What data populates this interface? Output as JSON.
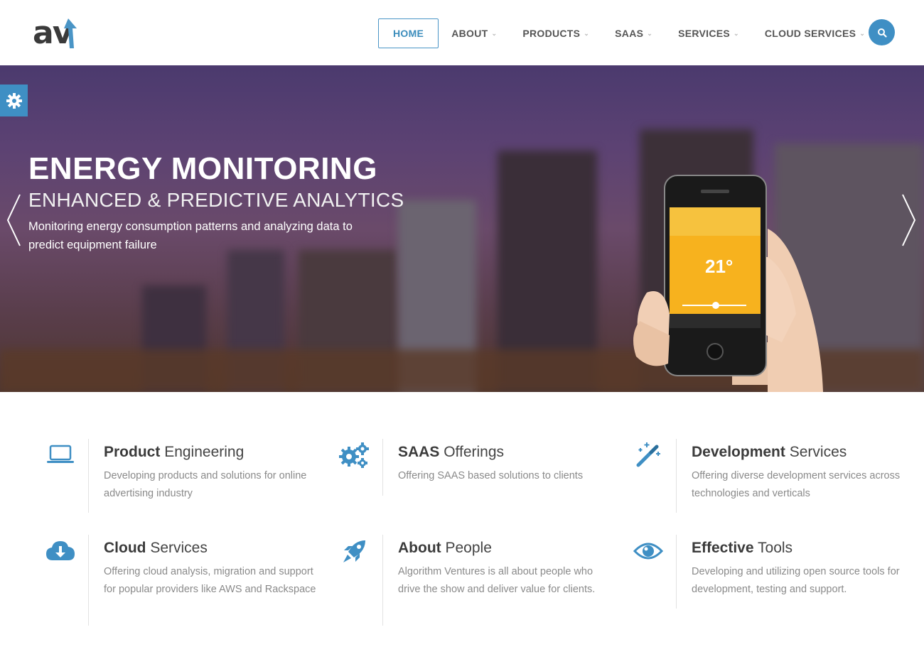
{
  "brand": {
    "logo_text": "av"
  },
  "nav": {
    "items": [
      {
        "label": "HOME"
      },
      {
        "label": "ABOUT"
      },
      {
        "label": "PRODUCTS"
      },
      {
        "label": "SAAS"
      },
      {
        "label": "SERVICES"
      },
      {
        "label": "CLOUD SERVICES"
      }
    ],
    "search_icon": "search-icon"
  },
  "hero": {
    "title": "ENERGY MONITORING",
    "subtitle": "ENHANCED & PREDICTIVE ANALYTICS",
    "description": "Monitoring energy consumption patterns and analyzing data to predict equipment failure",
    "phone_temp": "21°",
    "settings_icon": "gear-icon"
  },
  "features": [
    {
      "title_bold": "Product",
      "title_rest": "Engineering",
      "desc": "Developing products and solutions for online advertising industry",
      "icon": "laptop-icon"
    },
    {
      "title_bold": "SAAS",
      "title_rest": "Offerings",
      "desc": "Offering SAAS based solutions to clients",
      "icon": "gears-icon"
    },
    {
      "title_bold": "Development",
      "title_rest": "Services",
      "desc": "Offering diverse development services across technologies and verticals",
      "icon": "magic-wand-icon"
    },
    {
      "title_bold": "Cloud",
      "title_rest": "Services",
      "desc": "Offering cloud analysis, migration and support for popular providers like AWS and Rackspace",
      "icon": "cloud-download-icon"
    },
    {
      "title_bold": "About",
      "title_rest": "People",
      "desc": "Algorithm Ventures is all about people who drive the show and deliver value for clients.",
      "icon": "rocket-icon"
    },
    {
      "title_bold": "Effective",
      "title_rest": "Tools",
      "desc": "Developing and utilizing open source tools for development, testing and support.",
      "icon": "eye-icon"
    }
  ],
  "colors": {
    "accent": "#3f8fc4",
    "text": "#444444",
    "muted": "#8a8a8a"
  }
}
